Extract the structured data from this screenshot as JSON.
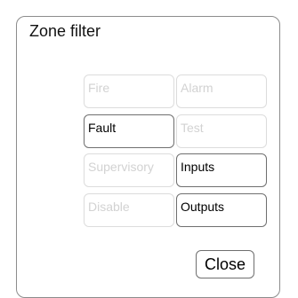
{
  "dialog": {
    "title": "Zone filter",
    "filters": [
      {
        "label": "Fire",
        "selected": false
      },
      {
        "label": "Alarm",
        "selected": false
      },
      {
        "label": "Fault",
        "selected": true
      },
      {
        "label": "Test",
        "selected": false
      },
      {
        "label": "Supervisory",
        "selected": false
      },
      {
        "label": "Inputs",
        "selected": true
      },
      {
        "label": "Disable",
        "selected": false
      },
      {
        "label": "Outputs",
        "selected": true
      }
    ],
    "close_label": "Close"
  }
}
